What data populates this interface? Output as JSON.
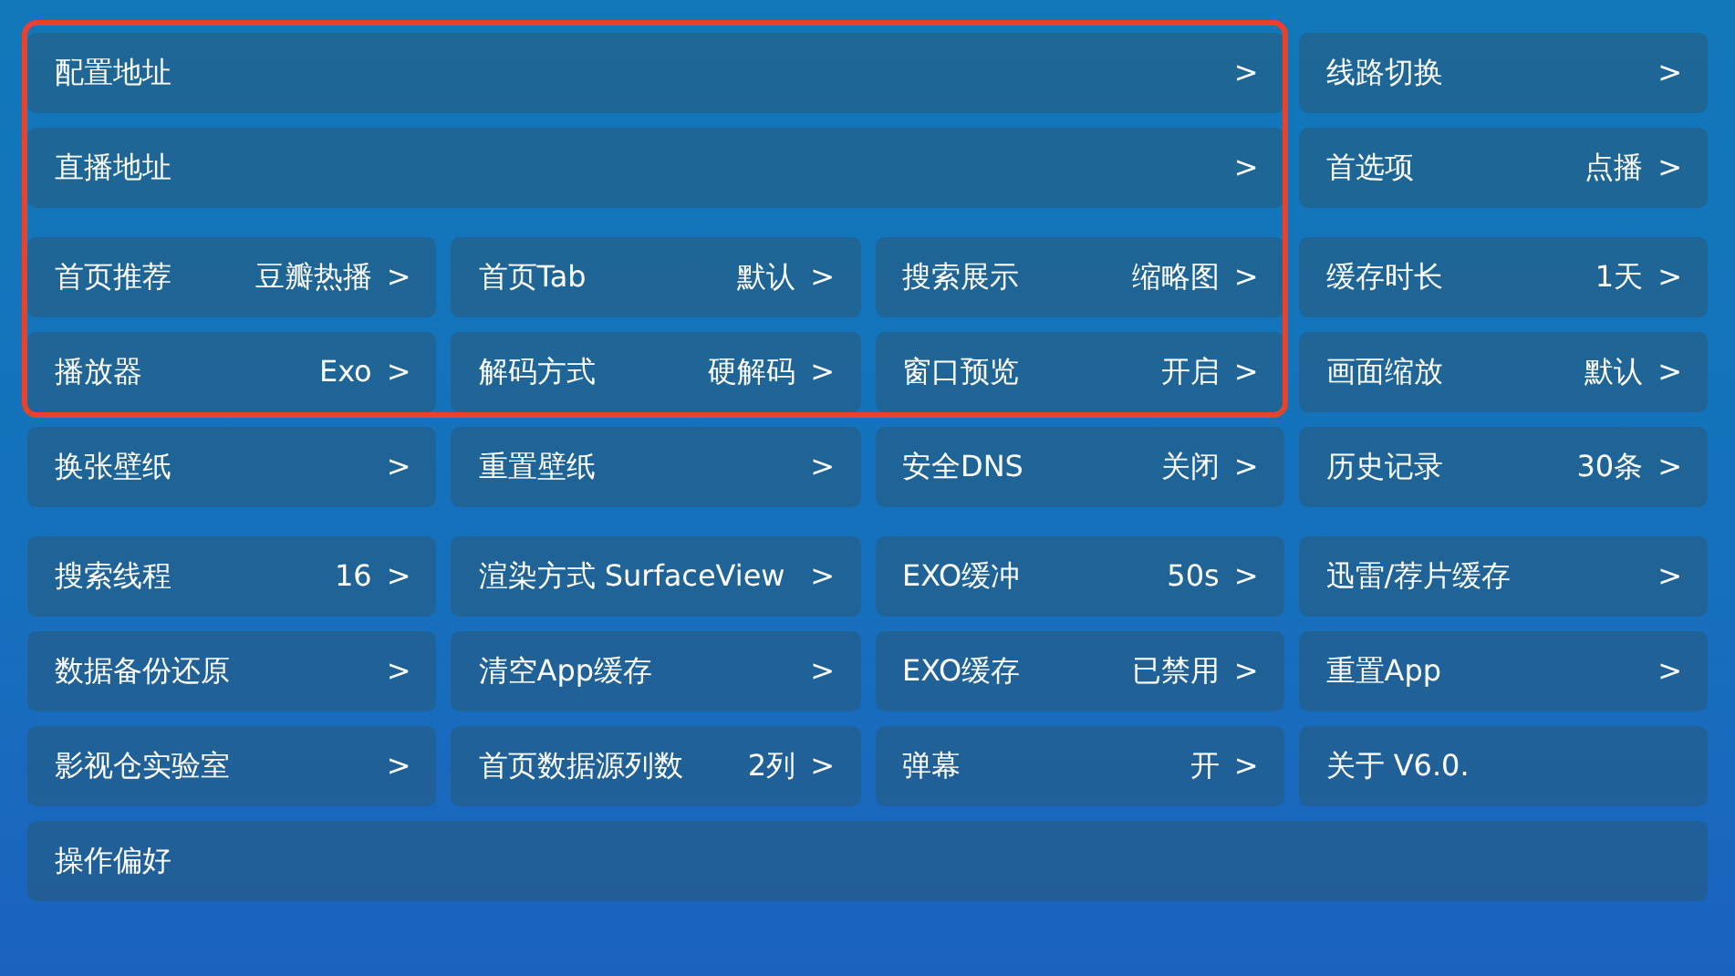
{
  "highlight": {
    "color": "#e8412c"
  },
  "sections": [
    [
      {
        "label": "配置地址",
        "arrow": ">",
        "kind": "wide"
      },
      {
        "label": "线路切换",
        "arrow": ">",
        "kind": "item"
      },
      {
        "label": "直播地址",
        "arrow": ">",
        "kind": "wide"
      },
      {
        "label": "首选项",
        "value": "点播",
        "arrow": ">",
        "kind": "item"
      }
    ],
    [
      {
        "label": "首页推荐",
        "value": "豆瓣热播",
        "arrow": ">",
        "kind": "item"
      },
      {
        "label": "首页Tab",
        "value": "默认",
        "arrow": ">",
        "kind": "item"
      },
      {
        "label": "搜索展示",
        "value": "缩略图",
        "arrow": ">",
        "kind": "item"
      },
      {
        "label": "缓存时长",
        "value": "1天",
        "arrow": ">",
        "kind": "item"
      },
      {
        "label": "播放器",
        "value": "Exo",
        "arrow": ">",
        "kind": "item"
      },
      {
        "label": "解码方式",
        "value": "硬解码",
        "arrow": ">",
        "kind": "item"
      },
      {
        "label": "窗口预览",
        "value": "开启",
        "arrow": ">",
        "kind": "item"
      },
      {
        "label": "画面缩放",
        "value": "默认",
        "arrow": ">",
        "kind": "item"
      },
      {
        "label": "换张壁纸",
        "arrow": ">",
        "kind": "item"
      },
      {
        "label": "重置壁纸",
        "arrow": ">",
        "kind": "item"
      },
      {
        "label": "安全DNS",
        "value": "关闭",
        "arrow": ">",
        "kind": "item"
      },
      {
        "label": "历史记录",
        "value": "30条",
        "arrow": ">",
        "kind": "item"
      }
    ],
    [
      {
        "label": "搜索线程",
        "value": "16",
        "arrow": ">",
        "kind": "item"
      },
      {
        "label": "渲染方式 SurfaceView",
        "arrow": ">",
        "kind": "item"
      },
      {
        "label": "EXO缓冲",
        "value": "50s",
        "arrow": ">",
        "kind": "item"
      },
      {
        "label": "迅雷/荐片缓存",
        "arrow": ">",
        "kind": "item"
      },
      {
        "label": "数据备份还原",
        "arrow": ">",
        "kind": "item"
      },
      {
        "label": "清空App缓存",
        "arrow": ">",
        "kind": "item"
      },
      {
        "label": "EXO缓存",
        "value": "已禁用",
        "arrow": ">",
        "kind": "item"
      },
      {
        "label": "重置App",
        "arrow": ">",
        "kind": "item"
      },
      {
        "label": "影视仓实验室",
        "arrow": ">",
        "kind": "item"
      },
      {
        "label": "首页数据源列数",
        "value": "2列",
        "arrow": ">",
        "kind": "item"
      },
      {
        "label": "弹幕",
        "value": "开",
        "arrow": ">",
        "kind": "item"
      },
      {
        "label": "关于 V6.0.",
        "kind": "item"
      },
      {
        "label": "操作偏好",
        "kind": "full"
      }
    ]
  ]
}
